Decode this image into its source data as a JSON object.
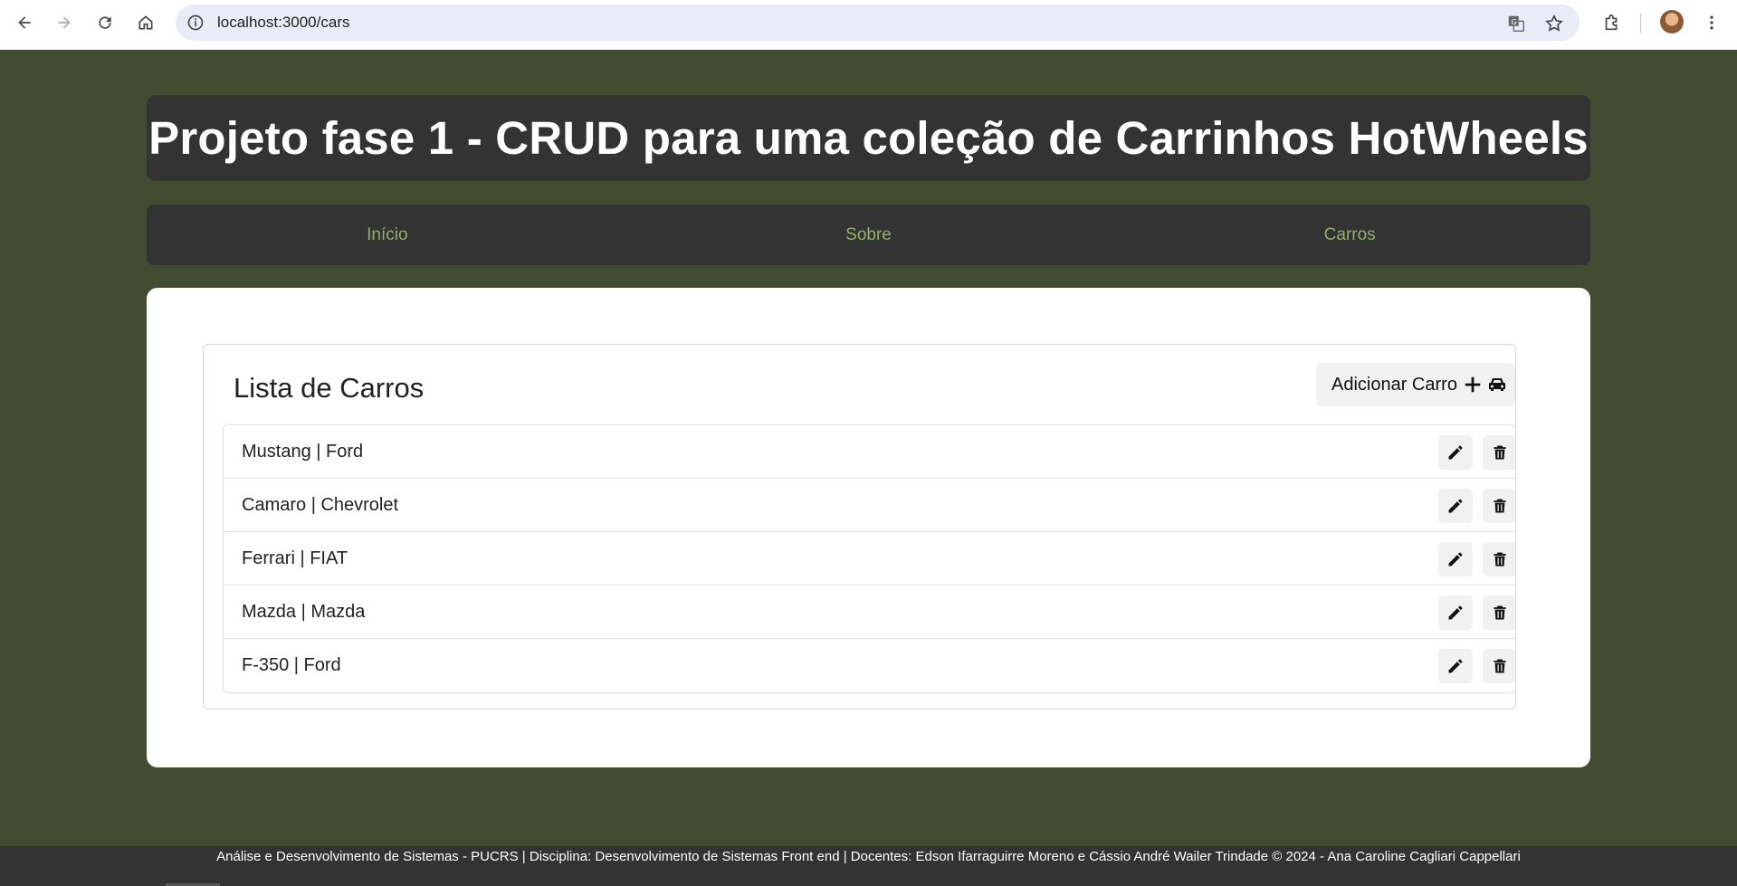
{
  "browser": {
    "url": "localhost:3000/cars",
    "icons": {
      "back": "back-arrow-icon",
      "forward": "forward-arrow-icon",
      "reload": "reload-icon",
      "home": "home-icon",
      "info": "info-icon",
      "translate": "translate-icon",
      "bookmark": "star-icon",
      "extensions": "puzzle-icon",
      "menu": "kebab-menu-icon"
    }
  },
  "page": {
    "title": "Projeto fase 1 - CRUD para uma coleção de Carrinhos HotWheels",
    "nav": [
      {
        "label": "Início"
      },
      {
        "label": "Sobre"
      },
      {
        "label": "Carros"
      }
    ],
    "list": {
      "title": "Lista de Carros",
      "add_label": "Adicionar Carro",
      "items": [
        {
          "label": "Mustang | Ford"
        },
        {
          "label": "Camaro | Chevrolet"
        },
        {
          "label": "Ferrari | FIAT"
        },
        {
          "label": "Mazda | Mazda"
        },
        {
          "label": "F-350 | Ford"
        }
      ]
    },
    "footer": "Análise e Desenvolvimento de Sistemas - PUCRS | Disciplina: Desenvolvimento de Sistemas Front end | Docentes: Edson Ifarraguirre Moreno e Cássio André Wailer Trindade © 2024 - Ana Caroline Cagliari Cappellari"
  },
  "colors": {
    "page_bg": "#414c31",
    "panel_bg": "#333333",
    "nav_link": "#90b06a"
  }
}
